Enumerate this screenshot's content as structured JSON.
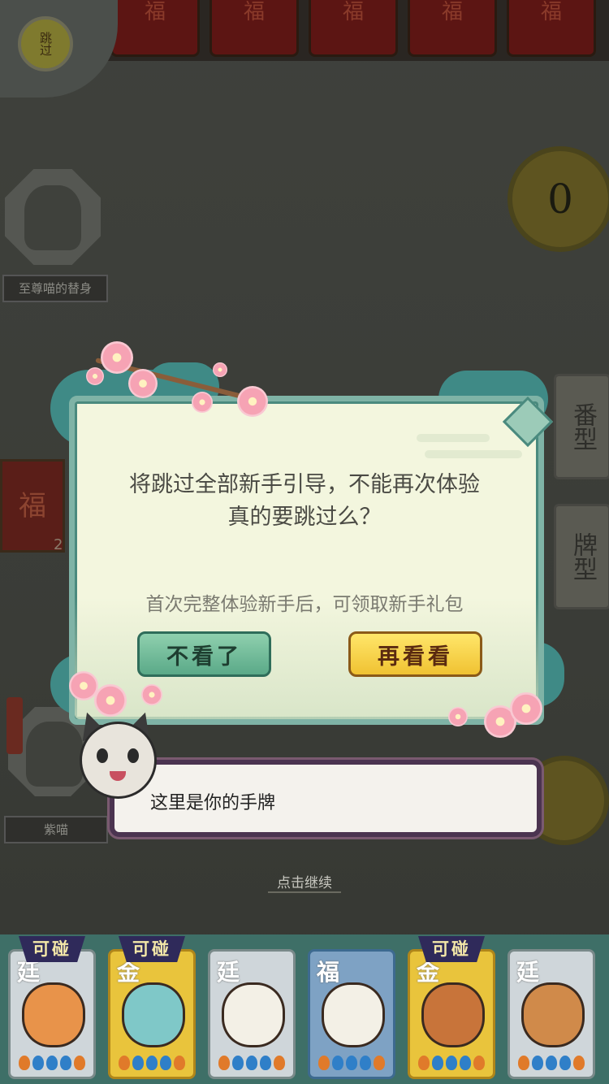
{
  "top_cards": [
    "福",
    "福",
    "福",
    "福",
    "福"
  ],
  "skip_button": {
    "label": "跳过"
  },
  "opponent_left": {
    "name": "至尊喵的替身"
  },
  "score_top_right": "0",
  "side_buttons": [
    "番型",
    "牌型"
  ],
  "left_card": {
    "char": "福",
    "count": "2"
  },
  "dialog": {
    "line1": "将跳过全部新手引导，不能再次体验",
    "line2": "真的要跳过么？",
    "hint": "首次完整体验新手后，可领取新手礼包",
    "btn_no": "不看了",
    "btn_again": "再看看"
  },
  "self_player": {
    "name": "紫喵"
  },
  "guide_bubble": {
    "text": "这里是你的手牌"
  },
  "continue_label": "点击继续",
  "hand_tiles": [
    {
      "char": "廷",
      "kind": "normal",
      "animal": "tiger",
      "badge": "可碰"
    },
    {
      "char": "金",
      "kind": "gold",
      "animal": "dragon",
      "badge": "可碰"
    },
    {
      "char": "廷",
      "kind": "normal",
      "animal": "sheep",
      "badge": ""
    },
    {
      "char": "福",
      "kind": "blue",
      "animal": "sheep",
      "badge": ""
    },
    {
      "char": "金",
      "kind": "gold",
      "animal": "monkey",
      "badge": "可碰"
    },
    {
      "char": "廷",
      "kind": "normal",
      "animal": "dog",
      "badge": ""
    }
  ],
  "colors": {
    "accent_green": "#5aa988",
    "accent_yellow": "#f0c232",
    "dialog_bg": "#f3f6de"
  }
}
